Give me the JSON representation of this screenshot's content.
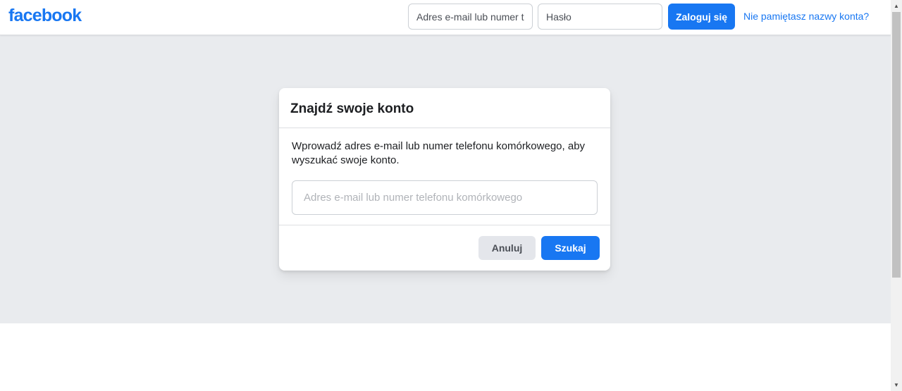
{
  "header": {
    "logo_text": "facebook",
    "email_placeholder": "Adres e-mail lub numer telefonu",
    "password_placeholder": "Hasło",
    "login_label": "Zaloguj się",
    "forgot_label": "Nie pamiętasz nazwy konta?"
  },
  "dialog": {
    "title": "Znajdź swoje konto",
    "description": "Wprowadź adres e-mail lub numer telefonu komórkowego, aby wyszukać swoje konto.",
    "input_placeholder": "Adres e-mail lub numer telefonu komórkowego",
    "cancel_label": "Anuluj",
    "search_label": "Szukaj"
  },
  "scrollbar": {
    "up_icon": "scroll-up-arrow",
    "down_icon": "scroll-down-arrow",
    "up_glyph": "▲",
    "down_glyph": "▼"
  },
  "colors": {
    "brand": "#1877f2",
    "page_bg": "#e9ebee"
  }
}
